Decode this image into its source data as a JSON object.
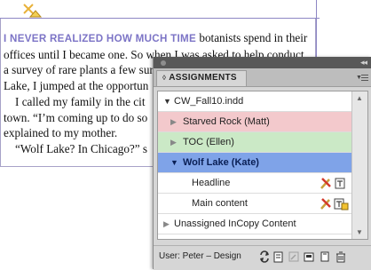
{
  "document": {
    "lead_in": "I NEVER REALIZED HOW MUCH TIME",
    "lines": [
      " botanists spend in their",
      "offices until I became one. So when I was asked to help conduct",
      "a survey of rare plants a few sur",
      "Lake, I jumped at the opportun",
      "I called my family in the cit",
      "town. “I’m coming up to do so",
      "explained to my mother.",
      "“Wolf Lake? In Chicago?” s"
    ]
  },
  "panel": {
    "tab_label": "ASSIGNMENTS",
    "menu_icon": "panel-menu-icon",
    "tree": [
      {
        "label": "CW_Fall10.indd",
        "kind": "document",
        "expanded": true
      },
      {
        "label": "Starved Rock (Matt)",
        "kind": "assignment",
        "color": "#f3c9cc"
      },
      {
        "label": "TOC (Ellen)",
        "kind": "assignment",
        "color": "#cbe9c6"
      },
      {
        "label": "Wolf Lake (Kate)",
        "kind": "assignment",
        "color": "#7fa3e8",
        "selected": true,
        "expanded": true
      },
      {
        "label": "Headline",
        "kind": "content"
      },
      {
        "label": "Main content",
        "kind": "content"
      },
      {
        "label": "Unassigned InCopy Content",
        "kind": "group"
      }
    ],
    "footer": {
      "user_label": "User: Peter – Design",
      "buttons": [
        "update-content-icon",
        "relink-icon",
        "new-assignment-icon",
        "assign-icon",
        "delete-icon"
      ]
    }
  }
}
